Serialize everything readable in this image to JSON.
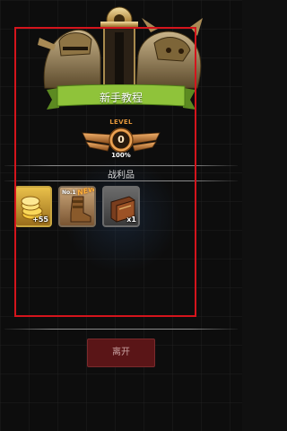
{
  "tutorial_title": "新手教程",
  "level": {
    "label": "LEVEL",
    "value": "0",
    "progress_text": "100%"
  },
  "spoils": {
    "title": "战利品",
    "items": [
      {
        "name": "gold-coins",
        "count": "+55"
      },
      {
        "name": "boot-card",
        "rank": "No.1",
        "badge": "NEW"
      },
      {
        "name": "book",
        "count": "x1"
      }
    ]
  },
  "leave_button": "离开",
  "colors": {
    "ribbon_green": "#8fc33a",
    "level_orange": "#e3963a",
    "leave_button_bg": "#5a1517",
    "frame_red": "#d4141c"
  }
}
